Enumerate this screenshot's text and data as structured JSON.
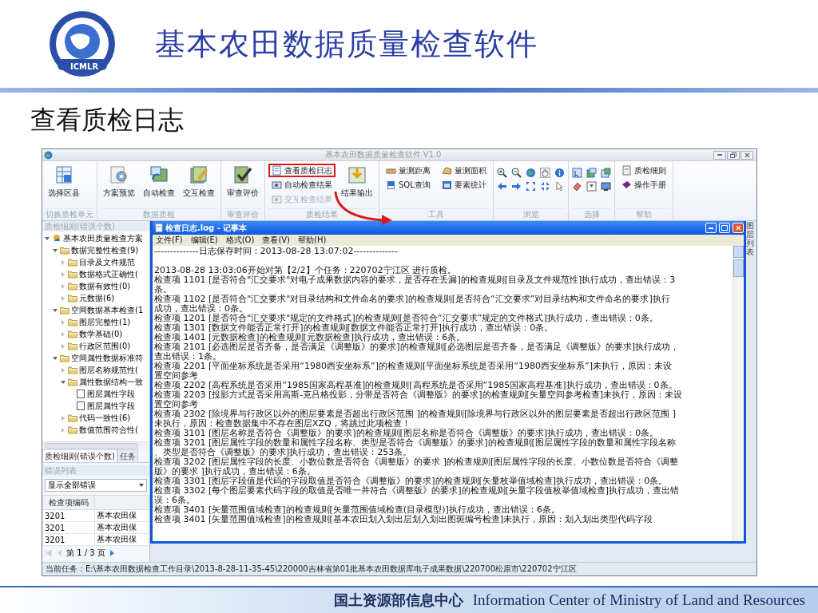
{
  "slide": {
    "logo_text": "ICMLR",
    "title": "基本农田数据质量检查软件",
    "subtitle": "查看质检日志",
    "footer_cn": "国土资源部信息中心",
    "footer_en": "Information Center of Ministry of Land and Resources"
  },
  "app": {
    "title": "基本农田数据质量检查软件 V1.0",
    "ribbon_groups": [
      {
        "label": "切换质检单元",
        "items": [
          {
            "kind": "large",
            "label": "选择区县"
          }
        ]
      },
      {
        "label": "数据质检",
        "items": [
          {
            "kind": "large",
            "label": "方案预览"
          },
          {
            "kind": "large",
            "label": "自动检查"
          },
          {
            "kind": "large",
            "label": "交互检查"
          }
        ]
      },
      {
        "label": "审查评价",
        "items": [
          {
            "kind": "large",
            "label": "审查评价"
          }
        ]
      },
      {
        "label": "质检结果",
        "items": [
          {
            "kind": "small",
            "label": "查看质检日志",
            "highlighted": true,
            "disabled": false
          },
          {
            "kind": "small",
            "label": "自动检查结果",
            "highlighted": false,
            "disabled": false
          },
          {
            "kind": "small",
            "label": "交互检查结果",
            "highlighted": false,
            "disabled": true
          },
          {
            "kind": "large",
            "label": "结果输出"
          }
        ]
      },
      {
        "label": "工具",
        "items": [
          {
            "kind": "small",
            "label": "量测距离",
            "highlighted": false,
            "disabled": false
          },
          {
            "kind": "small",
            "label": "量测面积",
            "highlighted": false,
            "disabled": false
          },
          {
            "kind": "small",
            "label": "SQL查询",
            "highlighted": false,
            "disabled": false
          },
          {
            "kind": "small",
            "label": "要素统计",
            "highlighted": false,
            "disabled": false
          }
        ]
      },
      {
        "label": "浏览",
        "items": [
          {
            "kind": "tool"
          },
          {
            "kind": "tool"
          },
          {
            "kind": "tool"
          },
          {
            "kind": "tool"
          },
          {
            "kind": "tool"
          },
          {
            "kind": "tool"
          },
          {
            "kind": "tool"
          },
          {
            "kind": "tool"
          },
          {
            "kind": "tool"
          },
          {
            "kind": "tool"
          }
        ]
      },
      {
        "label": "选择",
        "items": [
          {
            "kind": "tool"
          },
          {
            "kind": "tool"
          },
          {
            "kind": "tool"
          },
          {
            "kind": "tool"
          },
          {
            "kind": "tool"
          },
          {
            "kind": "tool"
          }
        ]
      },
      {
        "label": "帮助",
        "items": [
          {
            "kind": "small",
            "label": "质检细则",
            "highlighted": false,
            "disabled": false
          },
          {
            "kind": "small",
            "label": "操作手册",
            "highlighted": false,
            "disabled": false
          }
        ]
      }
    ],
    "left_panel": {
      "header": "质检细则(错误个数)",
      "tree": [
        {
          "kind": "scheme",
          "label": "基本农田质量检查方案",
          "expanded": true,
          "children": [
            {
              "kind": "folder",
              "label": "数据完整性检查(9)",
              "expanded": true,
              "children": [
                {
                  "kind": "folder",
                  "label": "目录及文件规范",
                  "expanded": false
                },
                {
                  "kind": "folder",
                  "label": "数据格式正确性(",
                  "expanded": false
                },
                {
                  "kind": "folder",
                  "label": "数据有效性(0)",
                  "expanded": false
                },
                {
                  "kind": "folder",
                  "label": "元数据(6)",
                  "expanded": false
                }
              ]
            },
            {
              "kind": "folder",
              "label": "空间数据基本检查(1",
              "expanded": true,
              "children": [
                {
                  "kind": "folder",
                  "label": "图层完整性(1)",
                  "expanded": false
                },
                {
                  "kind": "folder",
                  "label": "数学基础(0)",
                  "expanded": false
                },
                {
                  "kind": "folder",
                  "label": "行政区范围(0)",
                  "expanded": false
                }
              ]
            },
            {
              "kind": "folder",
              "label": "空间属性数据标准符",
              "expanded": true,
              "children": [
                {
                  "kind": "folder",
                  "label": "图层名称规范性(",
                  "expanded": false
                },
                {
                  "kind": "folder",
                  "label": "属性数据结构一致",
                  "expanded": true,
                  "children": [
                    {
                      "kind": "file",
                      "label": "图层属性字段"
                    },
                    {
                      "kind": "file",
                      "label": "图层属性字段"
                    }
                  ]
                },
                {
                  "kind": "folder",
                  "label": "代码一致性(6)",
                  "expanded": false
                },
                {
                  "kind": "folder",
                  "label": "数值范围符合性(",
                  "expanded": false
                }
              ]
            }
          ]
        }
      ],
      "tabs": [
        {
          "label": "质检细则(错误个数)",
          "selected": true
        },
        {
          "label": "任务",
          "selected": false
        }
      ],
      "error_list": {
        "title": "错误列表",
        "filter": "显示全部错误",
        "columns": [
          "检查项编码"
        ],
        "rows": [
          [
            "3201",
            "基本农田保"
          ],
          [
            "3201",
            "基本农田保"
          ],
          [
            "3201",
            "基本农田保"
          ]
        ],
        "pager": "第 1 / 3 页"
      }
    },
    "notepad": {
      "title": "检查日志.log - 记事本",
      "menu": [
        "文件(F)",
        "编辑(E)",
        "格式(O)",
        "查看(V)",
        "帮助(H)"
      ],
      "header_line": "--------------日志保存时间：2013-08-28 13:07:02--------------",
      "lines": [
        "2013-08-28 13:03:06开始对第【2/2】个任务：220702宁江区 进行质检。",
        "检查项 1101 [是否符合\"汇交要求\"对电子成果数据内容的要求，是否存在丢漏]的检查规则[目录及文件规范性]执行成功，查出错误：3",
        "条。",
        "检查项 1102 [是否符合\"汇交要求\"对目录结构和文件命名的要求]的检查规则[是否符合“汇交要求”对目录结构和文件命名的要求]执行",
        "成功，查出错误：0条。",
        "检查项 1201 [是否符合\"汇交要求\"规定的文件格式]的检查规则[是否符合“汇交要求”规定的文件格式]执行成功，查出错误：0条。",
        "检查项 1301 [数据文件能否正常打开]的检查规则[数据文件能否正常打开]执行成功，查出错误：0条。",
        "检查项 1401 [元数据检查]的检查规则[元数据检查]执行成功，查出错误：6条。",
        "检查项 2101 [必选图层是否齐备，是否满足《调整版》的要求]的检查规则[必选图层是否齐备，是否满足《调整版》的要求]执行成功，",
        "查出错误：1条。",
        "检查项 2201 [平面坐标系统是否采用“1980西安坐标系”]的检查规则[平面坐标系统是否采用“1980西安坐标系”]未执行，原因：未设",
        "置空间参考",
        "检查项 2202 [高程系统是否采用“1985国家高程基准]的检查规则[高程系统是否采用“1985国家高程基准]执行成功，查出错误：0条。",
        "检查项 2203 [投影方式是否采用高斯-克吕格投影，分带是否符合《调整版》的要求]的检查规则[矢量空间参考检查]未执行，原因：未设",
        "置空间参考",
        "检查项 2302 [除境界与行政区以外的图层要素是否超出行政区范围 ]的检查规则[除境界与行政区以外的图层要素是否超出行政区范围 ]",
        "未执行，原因：检查数据集中不存在图层XZQ，将跳过此项检查！",
        "检查项 3101 [图层名称是否符合《调整版》的要求]的检查规则[图层名称是否符合《调整版》的要求]执行成功，查出错误：0条。",
        "检查项 3201 [图层属性字段的数量和属性字段名称、类型是否符合《调整版》的要求]的检查规则[图层属性字段的数量和属性字段名称",
        "、类型是否符合《调整版》的要求]执行成功，查出错误：253条。",
        "检查项 3202 [图层属性字段的长度、小数位数是否符合《调整版》的要求 ]的检查规则[图层属性字段的长度、小数位数是否符合《调整",
        "版》的要求 ]执行成功，查出错误：6条。",
        "检查项 3301 [图层字段值是代码的字段取值是否符合《调整版》的要求]的检查规则[矢量枚举值域检查]执行成功，查出错误：0条。",
        "检查项 3302 [每个图层要素代码字段的取值是否唯一并符合《调整版》的要求]的检查规则[矢量字段值枚举值域检查]执行成功，查出错",
        "误：6条。",
        "检查项 3401 [矢量范围值域检查]的检查规则[矢量范围值域检查(目录模型)]执行成功，查出错误：6条。",
        "检查项 3401 [矢量范围值域检查]的检查规则[基本农田划入划出层划入划出图斑编号检查]未执行，原因：划入划出类型代码字段"
      ]
    },
    "side_strip": "图层列表",
    "status_bar": "当前任务：E:\\基本农田数据检查工作目录\\2013-8-28-11-35-45\\220000吉林省第01批基本农田数据库电子成果数据\\220700松原市\\220702宁江区"
  }
}
